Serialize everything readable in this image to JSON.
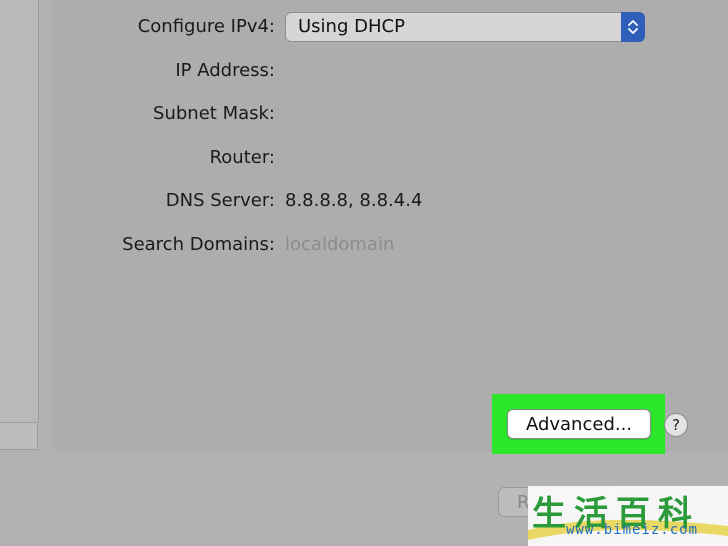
{
  "network": {
    "configure_ipv4": {
      "label": "Configure IPv4:",
      "value": "Using DHCP"
    },
    "ip_address": {
      "label": "IP Address:",
      "value": ""
    },
    "subnet_mask": {
      "label": "Subnet Mask:",
      "value": ""
    },
    "router": {
      "label": "Router:",
      "value": ""
    },
    "dns_server": {
      "label": "DNS Server:",
      "value": "8.8.8.8, 8.8.4.4"
    },
    "search_domains": {
      "label": "Search Domains:",
      "value": "localdomain"
    }
  },
  "buttons": {
    "advanced": "Advanced...",
    "help": "?",
    "revert": "R"
  },
  "watermark": {
    "chars": "生活百科",
    "url": "www.bimeiz.com"
  },
  "colors": {
    "highlight": "#2ce62c",
    "stepper_accent": "#2f5fb8",
    "watermark_green": "#2a9a3a",
    "watermark_blue": "#1a6fc0"
  },
  "icons": {
    "stepper": "up-down-chevron-icon"
  }
}
